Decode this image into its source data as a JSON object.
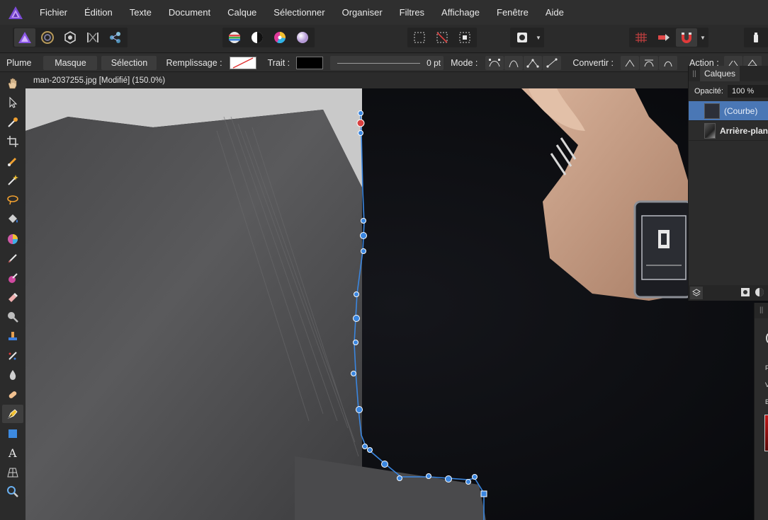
{
  "menu": {
    "items": [
      "Fichier",
      "Édition",
      "Texte",
      "Document",
      "Calque",
      "Sélectionner",
      "Organiser",
      "Filtres",
      "Affichage",
      "Fenêtre",
      "Aide"
    ]
  },
  "context": {
    "tool_name": "Plume",
    "mask_label": "Masque",
    "selection_label": "Sélection",
    "fill_label": "Remplissage :",
    "stroke_label": "Trait :",
    "stroke_width": "0 pt",
    "mode_label": "Mode :",
    "convert_label": "Convertir :",
    "action_label": "Action :"
  },
  "document": {
    "tab_title": "man-2037255.jpg [Modifié] (150.0%)"
  },
  "layers": {
    "tab_label": "Calques",
    "opacity_label": "Opacité:",
    "opacity_value": "100 %",
    "items": [
      {
        "name": "(Courbe)",
        "selected": true
      },
      {
        "name": "Arrière-plan",
        "selected": false
      }
    ]
  },
  "color_panel": {
    "letters": [
      "F",
      "V",
      "B"
    ]
  },
  "colors": {
    "accent": "#4a77b5",
    "path": "#3a86e0",
    "app_bg": "#2b2b2b"
  }
}
